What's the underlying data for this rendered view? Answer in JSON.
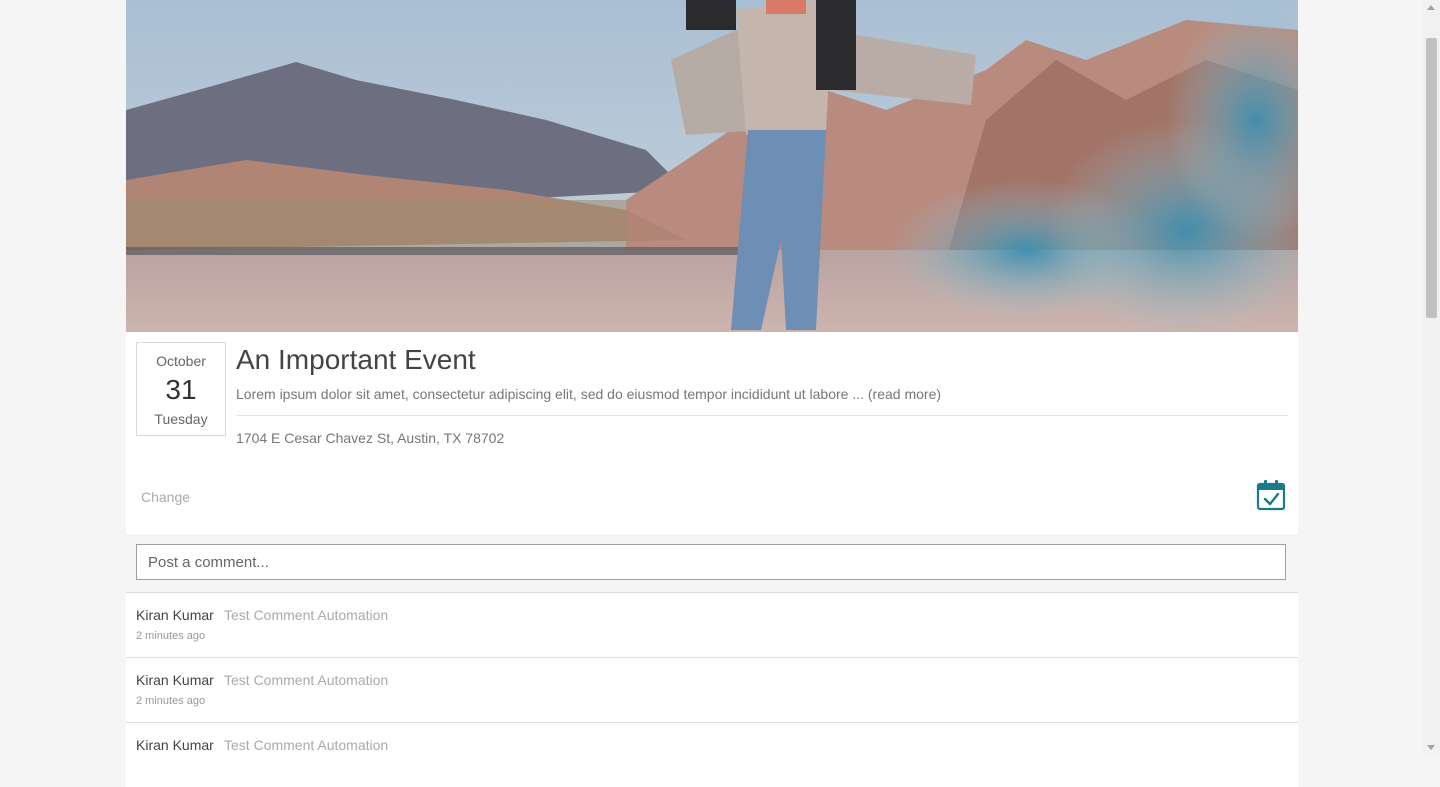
{
  "event": {
    "image_alt": "child with jetpack wings on desert road",
    "date": {
      "month": "October",
      "day": "31",
      "weekday": "Tuesday"
    },
    "title": "An Important Event",
    "description": "Lorem ipsum dolor sit amet, consectetur adipiscing elit, sed do eiusmod tempor incididunt ut labore ",
    "read_more": " ... (read more)",
    "address": "1704 E Cesar Chavez St, Austin, TX 78702",
    "change_label": "Change",
    "calendar_icon": "calendar-check-icon",
    "accent_color": "#1a7a8c"
  },
  "comment_box": {
    "placeholder": "Post a comment..."
  },
  "comments": [
    {
      "author": "Kiran Kumar",
      "text": "Test Comment Automation",
      "time": "2 minutes ago"
    },
    {
      "author": "Kiran Kumar",
      "text": "Test Comment Automation",
      "time": "2 minutes ago"
    },
    {
      "author": "Kiran Kumar",
      "text": "Test Comment Automation",
      "time": ""
    }
  ]
}
